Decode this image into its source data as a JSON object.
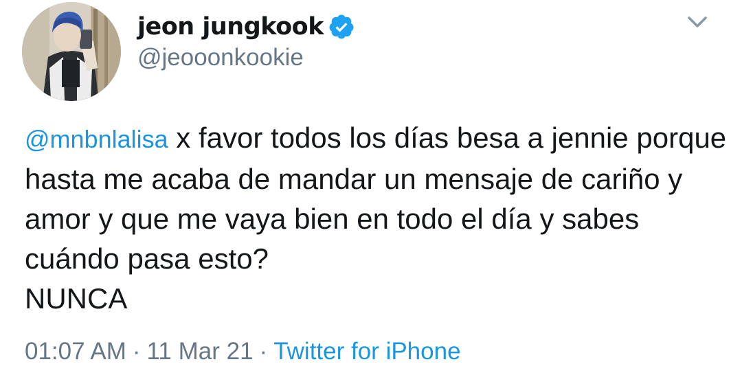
{
  "user": {
    "display_name": "jeon jungkook",
    "handle": "@jeooonkookie",
    "verified": true
  },
  "tweet": {
    "mention": "@mnbnlalisa",
    "body": " x favor todos los días besa a jennie porque hasta me acaba de mandar un mensaje de cariño y amor y que me vaya bien en todo el día y sabes cuándo pasa esto?\nNUNCA",
    "time": "01:07 AM",
    "date": "11 Mar 21",
    "separator": "·",
    "source": "Twitter for iPhone"
  },
  "icons": {
    "verified": "verified-badge-icon",
    "menu": "chevron-down-icon"
  },
  "colors": {
    "link": "#1b95e0",
    "secondary_text": "#657786",
    "primary_text": "#14171a",
    "verified": "#1da1f2"
  }
}
